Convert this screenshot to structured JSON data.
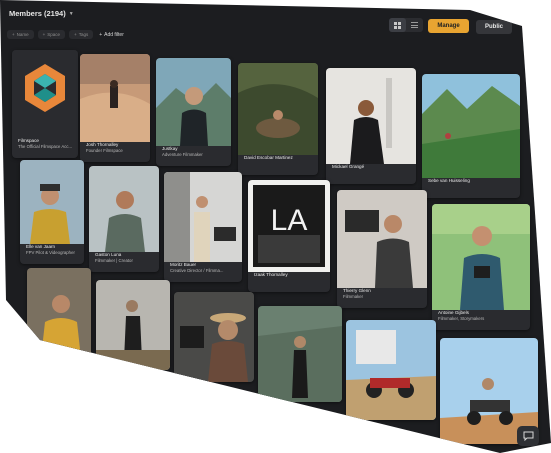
{
  "header": {
    "title": "Members (2194)",
    "manage_label": "Manage",
    "public_label": "Public"
  },
  "filters": {
    "chips": [
      "Name",
      "Space",
      "Tags"
    ],
    "add_label": "Add filter"
  },
  "colors": {
    "accent": "#e8a431",
    "background": "#1c1d20",
    "card": "#2a2b2f"
  },
  "members": [
    {
      "name": "Filmspace",
      "subtitle": "The Official Filmspace Acc..."
    },
    {
      "name": "Josh Thornalley",
      "subtitle": "Founder Filmspace"
    },
    {
      "name": "Justkay",
      "subtitle": "Adventure Filmmaker"
    },
    {
      "name": "David Escobar Martinez",
      "subtitle": ""
    },
    {
      "name": "Mickael Grangé",
      "subtitle": ""
    },
    {
      "name": "Sebe van Huisseling",
      "subtitle": ""
    },
    {
      "name": "Elle van Jaarn",
      "subtitle": "FPV Pilot & Videographer"
    },
    {
      "name": "Gaston Luna",
      "subtitle": "Filmmaker | Creator"
    },
    {
      "name": "Moritz Bauer",
      "subtitle": "Creative Director / Filmma..."
    },
    {
      "name": "Izaak Thornalley",
      "subtitle": ""
    },
    {
      "name": "Thierry Glenn",
      "subtitle": "Filmmaker"
    },
    {
      "name": "Antoine Gijbels",
      "subtitle": "Filmmaker, Storymakers"
    },
    {
      "name": "",
      "subtitle": ""
    },
    {
      "name": "",
      "subtitle": ""
    },
    {
      "name": "",
      "subtitle": ""
    },
    {
      "name": "",
      "subtitle": ""
    },
    {
      "name": "",
      "subtitle": ""
    },
    {
      "name": "",
      "subtitle": ""
    },
    {
      "name": "",
      "subtitle": ""
    }
  ],
  "photo_text": {
    "la_sign": "LA"
  },
  "icons": {
    "chevron": "chevron-down-icon",
    "grid": "grid-view-icon",
    "list": "list-view-icon",
    "add": "plus-icon",
    "chat": "chat-icon"
  }
}
